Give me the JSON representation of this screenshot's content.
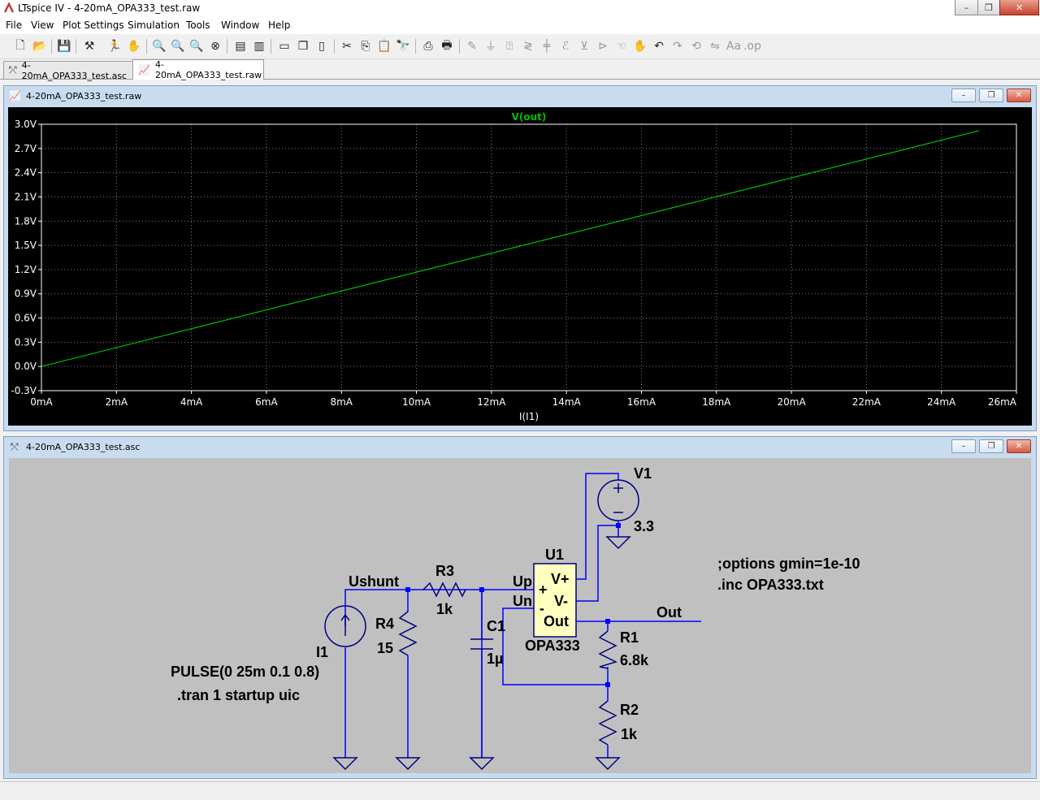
{
  "window": {
    "title": "LTspice IV - 4-20mA_OPA333_test.raw",
    "buttons": {
      "minimize": "–",
      "maximize": "❐",
      "close": "✕"
    }
  },
  "menu": [
    "File",
    "View",
    "Plot Settings",
    "Simulation",
    "Tools",
    "Window",
    "Help"
  ],
  "toolbar": {
    "icons": [
      "new-schematic-icon",
      "open-icon",
      "save-icon",
      "control-panel-icon",
      "run-icon",
      "halt-icon",
      "zoom-in-icon",
      "zoom-area-icon",
      "zoom-out-icon",
      "zoom-cancel-icon",
      "autorange-icon",
      "plot-icon",
      "tile-horizontal-icon",
      "cascade-icon",
      "tile-vertical-icon",
      "cut-icon",
      "copy-icon",
      "paste-icon",
      "find-icon",
      "print-icon",
      "print-preview-icon",
      "wire-icon",
      "ground-icon",
      "label-icon",
      "resistor-icon",
      "capacitor-icon",
      "inductor-icon",
      "diode-icon",
      "component-icon",
      "move-icon",
      "drag-icon",
      "undo-icon",
      "redo-icon",
      "rotate-icon",
      "mirror-icon",
      "text-icon",
      "spice-directive-icon"
    ]
  },
  "tabs": [
    {
      "label": "4-20mA_OPA333_test.asc",
      "active": false
    },
    {
      "label": "4-20mA_OPA333_test.raw",
      "active": true
    }
  ],
  "plot_window": {
    "title": "4-20mA_OPA333_test.raw",
    "buttons": {
      "minimize": "–",
      "restore": "❐",
      "close": "✕"
    }
  },
  "schematic_window": {
    "title": "4-20mA_OPA333_test.asc",
    "buttons": {
      "minimize": "–",
      "restore": "❐",
      "close": "✕"
    }
  },
  "chart_data": {
    "type": "line",
    "title": "V(out)",
    "xlabel": "I(I1)",
    "ylabel": "",
    "xlim": [
      0,
      26
    ],
    "ylim": [
      -0.3,
      3.0
    ],
    "grid": true,
    "x_ticks": [
      "0mA",
      "2mA",
      "4mA",
      "6mA",
      "8mA",
      "10mA",
      "12mA",
      "14mA",
      "16mA",
      "18mA",
      "20mA",
      "22mA",
      "24mA",
      "26mA"
    ],
    "x_tick_values": [
      0,
      2,
      4,
      6,
      8,
      10,
      12,
      14,
      16,
      18,
      20,
      22,
      24,
      26
    ],
    "y_ticks": [
      "3.0V",
      "2.7V",
      "2.4V",
      "2.1V",
      "1.8V",
      "1.5V",
      "1.2V",
      "0.9V",
      "0.6V",
      "0.3V",
      "0.0V",
      "-0.3V"
    ],
    "y_tick_values": [
      3.0,
      2.7,
      2.4,
      2.1,
      1.8,
      1.5,
      1.2,
      0.9,
      0.6,
      0.3,
      0.0,
      -0.3
    ],
    "series": [
      {
        "name": "V(out)",
        "color": "#00c000",
        "x": [
          0,
          25
        ],
        "y": [
          0.0,
          2.92
        ]
      }
    ],
    "colors": {
      "background": "#000000",
      "grid": "#808080",
      "axes": "#ffffff"
    }
  },
  "schematic": {
    "components": {
      "V1": {
        "name": "V1",
        "value": "3.3"
      },
      "U1": {
        "name": "U1",
        "model": "OPA333",
        "pins": {
          "plus": "+",
          "minus": "-",
          "vplus": "V+",
          "vminus": "V-",
          "out": "Out"
        }
      },
      "R3": {
        "name": "R3",
        "value": "1k"
      },
      "R4": {
        "name": "R4",
        "value": "15"
      },
      "C1": {
        "name": "C1",
        "value": "1µ"
      },
      "R1": {
        "name": "R1",
        "value": "6.8k"
      },
      "R2": {
        "name": "R2",
        "value": "1k"
      },
      "I1": {
        "name": "I1",
        "value": "PULSE(0 25m 0.1 0.8)"
      }
    },
    "net_labels": {
      "ushunt": "Ushunt",
      "up": "Up",
      "un": "Un",
      "out": "Out"
    },
    "directives": {
      "tran": ".tran 1 startup uic",
      "options": ";options gmin=1e-10",
      "inc": ".inc OPA333.txt"
    },
    "colors": {
      "wire": "#0000ff",
      "component": "#000080",
      "text": "#000000",
      "opamp_fill": "#ffffc0"
    }
  }
}
